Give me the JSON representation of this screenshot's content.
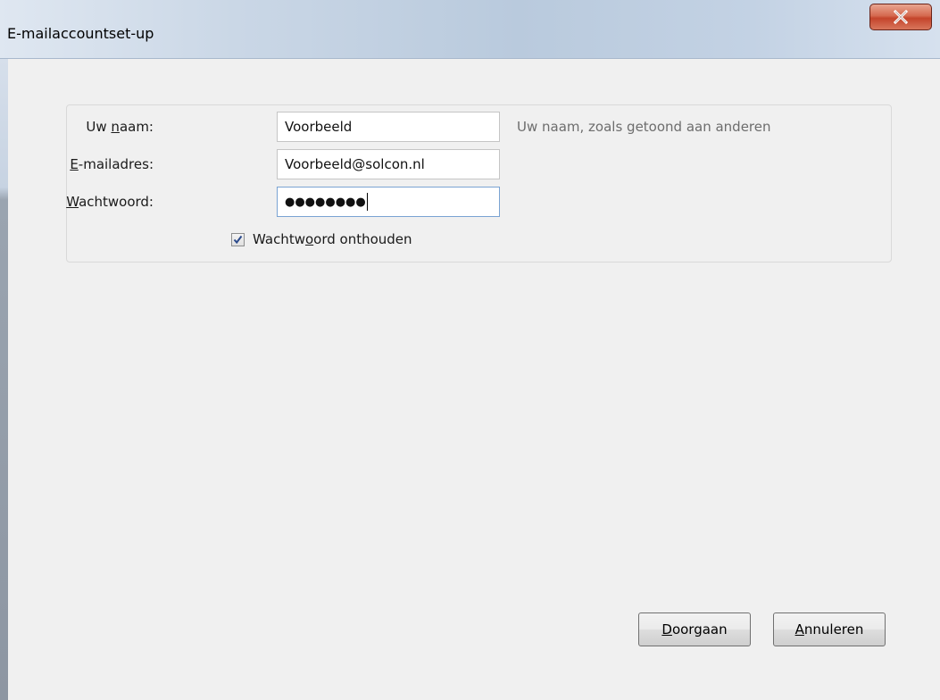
{
  "window": {
    "title": "E-mailaccountset-up",
    "close_glyph": "x"
  },
  "form": {
    "name": {
      "label_pre": "Uw ",
      "label_ul": "n",
      "label_post": "aam:",
      "value": "Voorbeeld",
      "hint": "Uw naam, zoals getoond aan anderen"
    },
    "email": {
      "label_pre": "",
      "label_ul": "E",
      "label_post": "-mailadres:",
      "value": "Voorbeeld@solcon.nl"
    },
    "password": {
      "label_pre": "",
      "label_ul": "W",
      "label_post": "achtwoord:",
      "value": "●●●●●●●●"
    },
    "remember": {
      "label_pre": "Wachtw",
      "label_ul": "o",
      "label_post": "ord onthouden",
      "checked": true
    }
  },
  "buttons": {
    "continue": {
      "ul": "D",
      "rest": "oorgaan"
    },
    "cancel": {
      "ul": "A",
      "rest": "nnuleren"
    }
  },
  "colors": {
    "close_button": "#c4442b",
    "focus_border": "#7aa3d3",
    "hint_text": "#6d6d6d"
  }
}
